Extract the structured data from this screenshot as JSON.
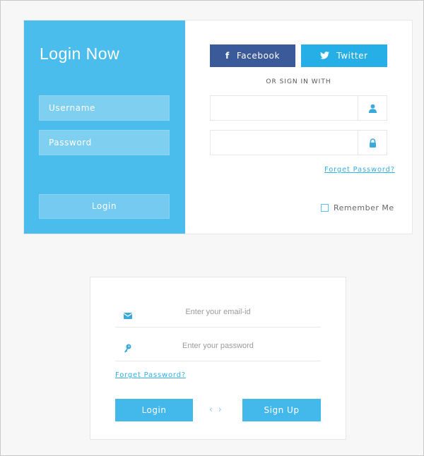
{
  "card1": {
    "title": "Login Now",
    "username_placeholder": "Username",
    "password_placeholder": "Password",
    "login_label": "Login",
    "facebook_label": "Facebook",
    "twitter_label": "Twitter",
    "or_text": "OR SIGN IN WITH",
    "forget_password": "Forget Password?",
    "remember_me": "Remember Me",
    "icons": {
      "facebook": "facebook-icon",
      "twitter": "twitter-icon",
      "user": "user-icon",
      "lock": "lock-icon"
    }
  },
  "card2": {
    "email_placeholder": "Enter your email-id",
    "password_placeholder": "Enter your password",
    "forget_password": "Forget Password?",
    "login_label": "Login",
    "signup_label": "Sign Up",
    "prev_arrow": "‹",
    "next_arrow": "›",
    "icons": {
      "email": "envelope-icon",
      "password": "key-icon"
    }
  },
  "colors": {
    "accent": "#4bbdec",
    "facebook": "#3b5a9a",
    "twitter": "#25afe6",
    "link": "#35aee2"
  }
}
